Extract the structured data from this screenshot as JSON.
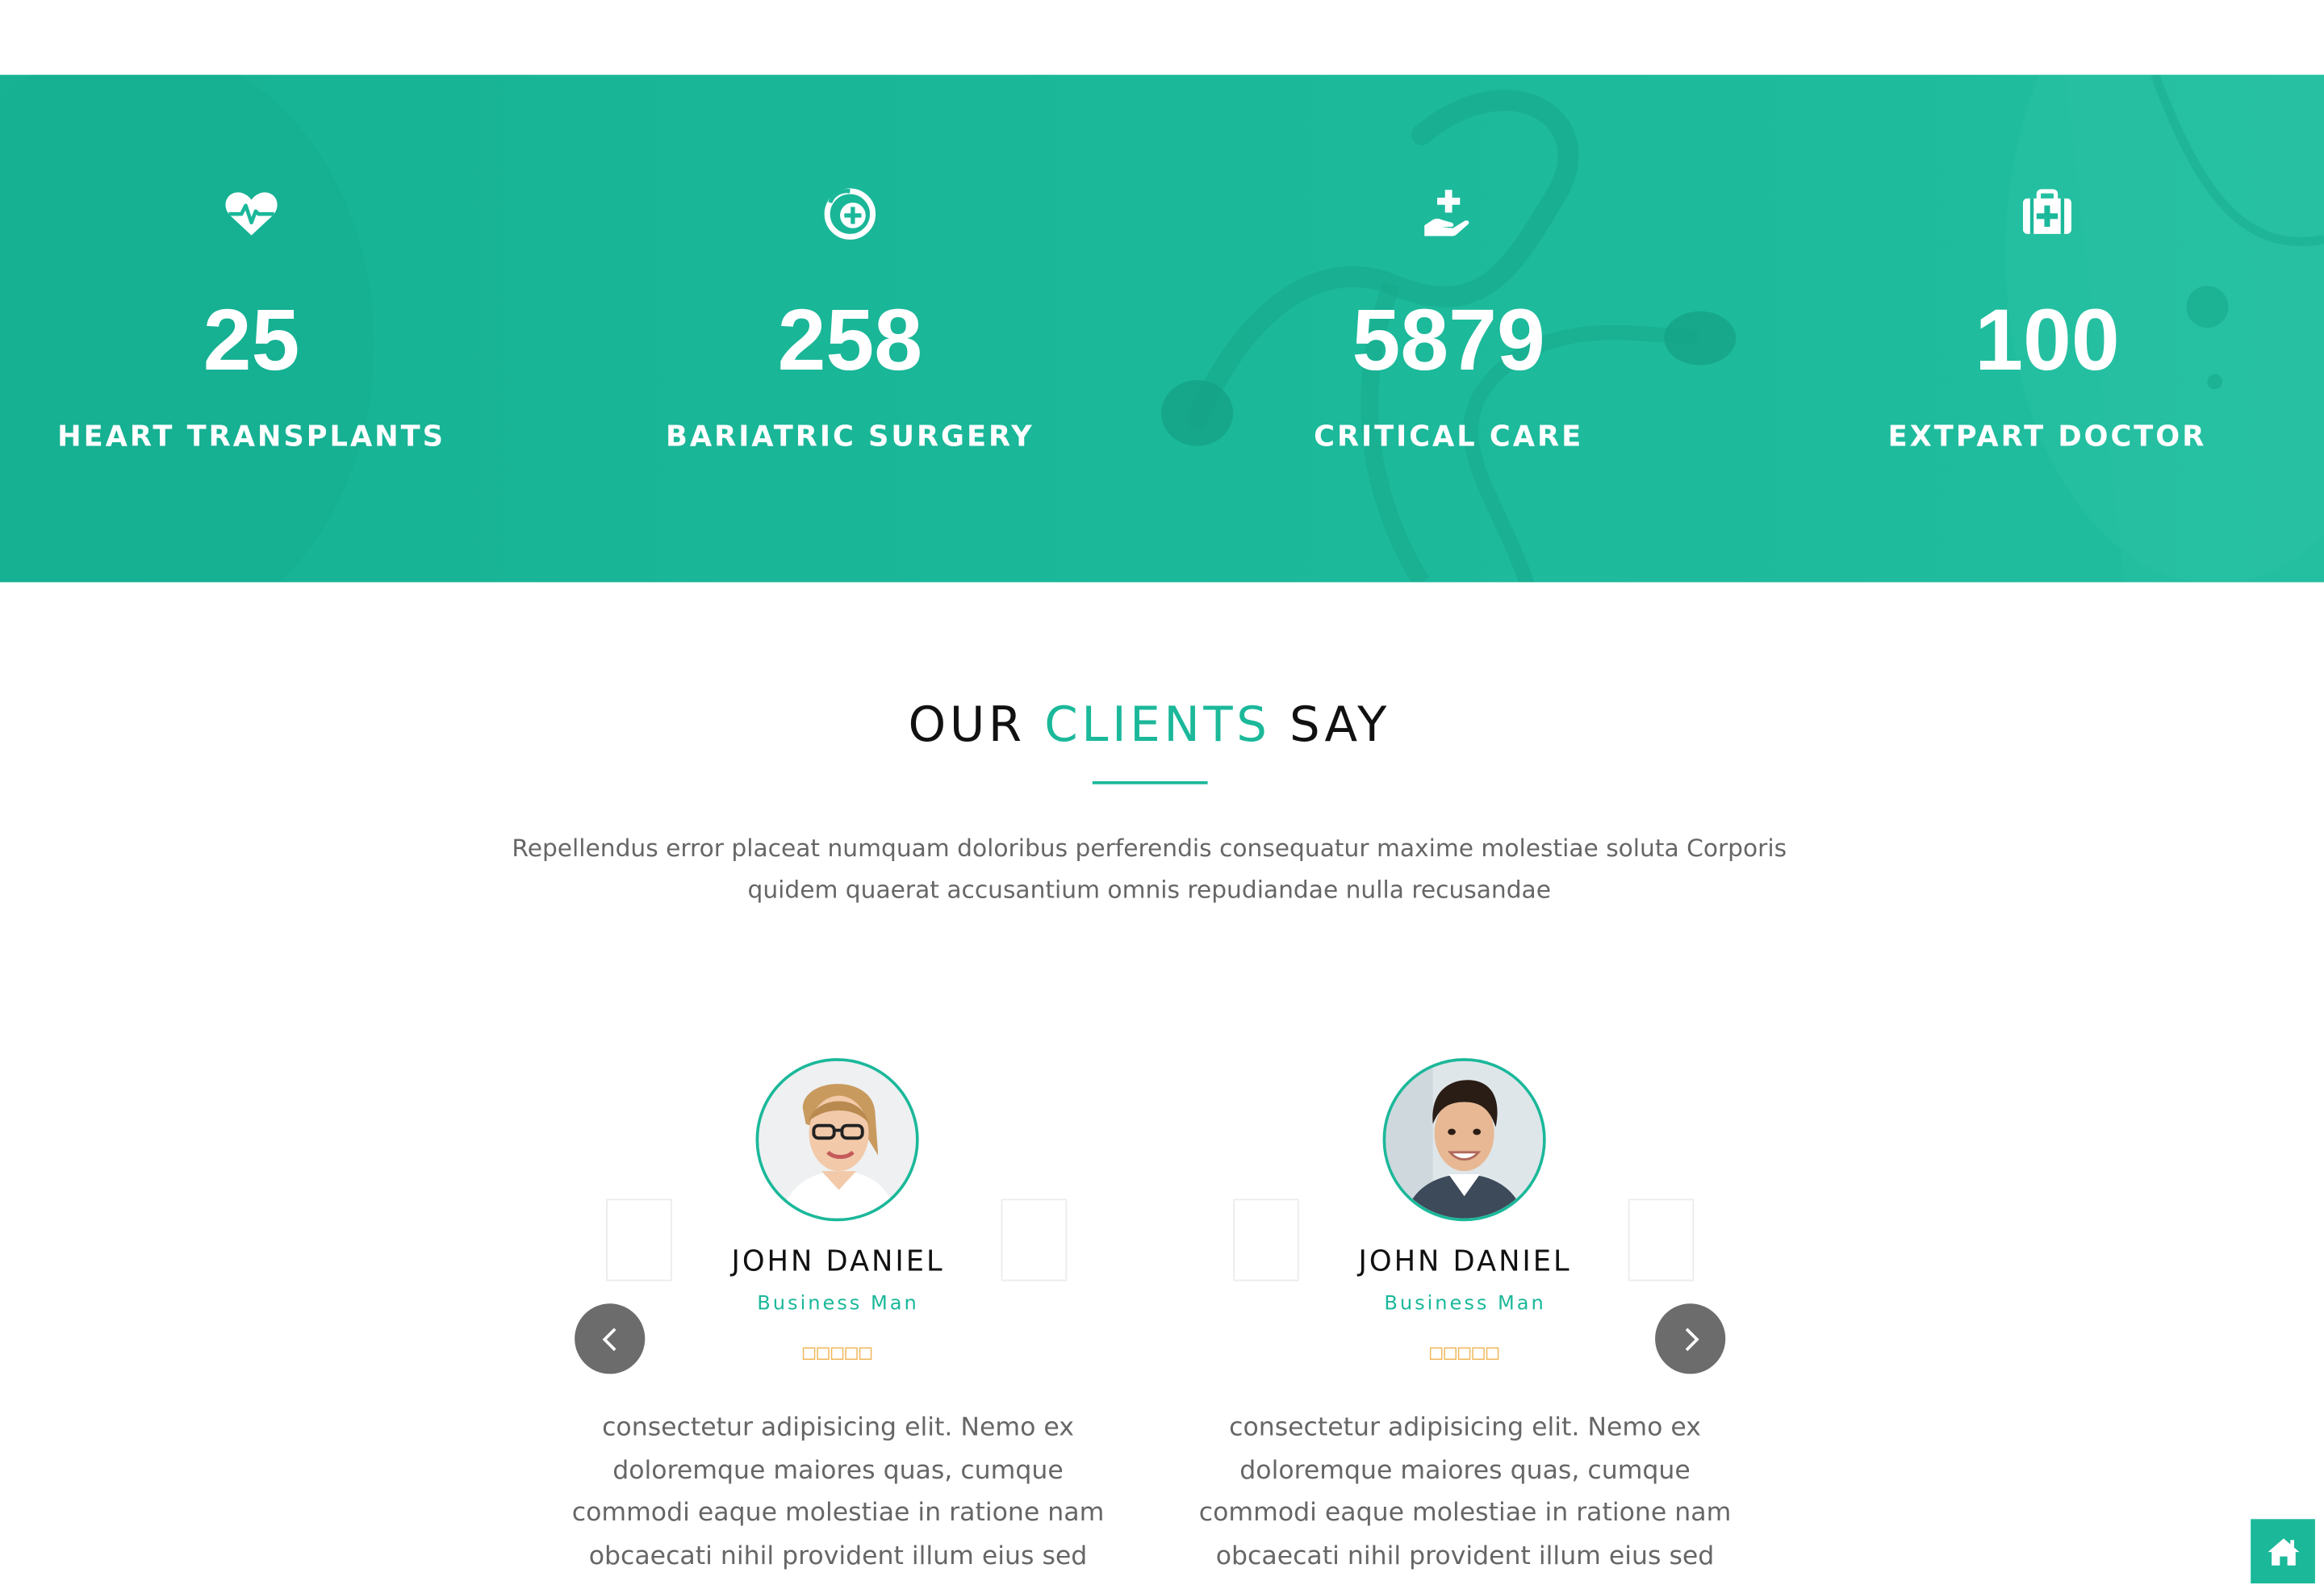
{
  "theme": {
    "accent": "#1bb89a",
    "nav_button": "#6c6c6c",
    "star_color": "#f0b75a",
    "text_muted": "#666666"
  },
  "counters": [
    {
      "icon": "heartbeat-icon",
      "value": "25",
      "label": "HEART TRANSPLANTS"
    },
    {
      "icon": "medical-circle-icon",
      "value": "258",
      "label": "BARIATRIC SURGERY"
    },
    {
      "icon": "hand-holding-medical-icon",
      "value": "5879",
      "label": "CRITICAL CARE"
    },
    {
      "icon": "first-aid-kit-icon",
      "value": "100",
      "label": "EXTPART DOCTOR"
    }
  ],
  "clients": {
    "title_part1": "OUR",
    "title_accent": "CLIENTS",
    "title_part2": "SAY",
    "description": "Repellendus error placeat numquam doloribus perferendis consequatur maxime molestiae soluta Corporis quidem quaerat accusantium omnis repudiandae nulla recusandae",
    "testimonials": [
      {
        "name": "JOHN DANIEL",
        "role": "Business Man",
        "stars": "□□□□□",
        "quote": "consectetur adipisicing elit. Nemo ex doloremque maiores quas, cumque commodi eaque molestiae in ratione nam obcaecati nihil provident illum eius sed ullam amet, expedita molestias iusto",
        "avatar": "woman-with-glasses-avatar"
      },
      {
        "name": "JOHN DANIEL",
        "role": "Business Man",
        "stars": "□□□□□",
        "quote": "consectetur adipisicing elit. Nemo ex doloremque maiores quas, cumque commodi eaque molestiae in ratione nam obcaecati nihil provident illum eius sed ullam amet, expedita molestias iusto",
        "avatar": "young-man-avatar"
      }
    ]
  },
  "controls": {
    "prev_icon": "chevron-left-icon",
    "next_icon": "chevron-right-icon",
    "home_icon": "home-icon"
  }
}
